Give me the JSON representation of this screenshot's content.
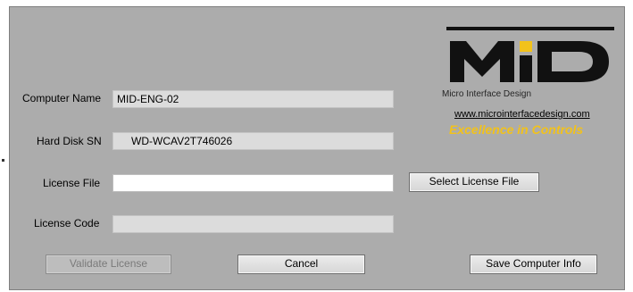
{
  "form": {
    "computer_name_label": "Computer Name",
    "computer_name_value": "MID-ENG-02",
    "hard_disk_label": "Hard Disk SN",
    "hard_disk_value": "WD-WCAV2T746026",
    "license_file_label": "License File",
    "license_file_value": "",
    "license_code_label": "License Code",
    "license_code_value": ""
  },
  "buttons": {
    "select_license_file": "Select License File",
    "validate_license": "Validate License",
    "cancel": "Cancel",
    "save_computer_info": "Save Computer Info"
  },
  "branding": {
    "logo_letters": "MiD",
    "company_name": "Micro Interface Design",
    "website": "www.microinterfacedesign.com",
    "slogan": "Excellence in Controls",
    "accent_color": "#f2c21b"
  }
}
